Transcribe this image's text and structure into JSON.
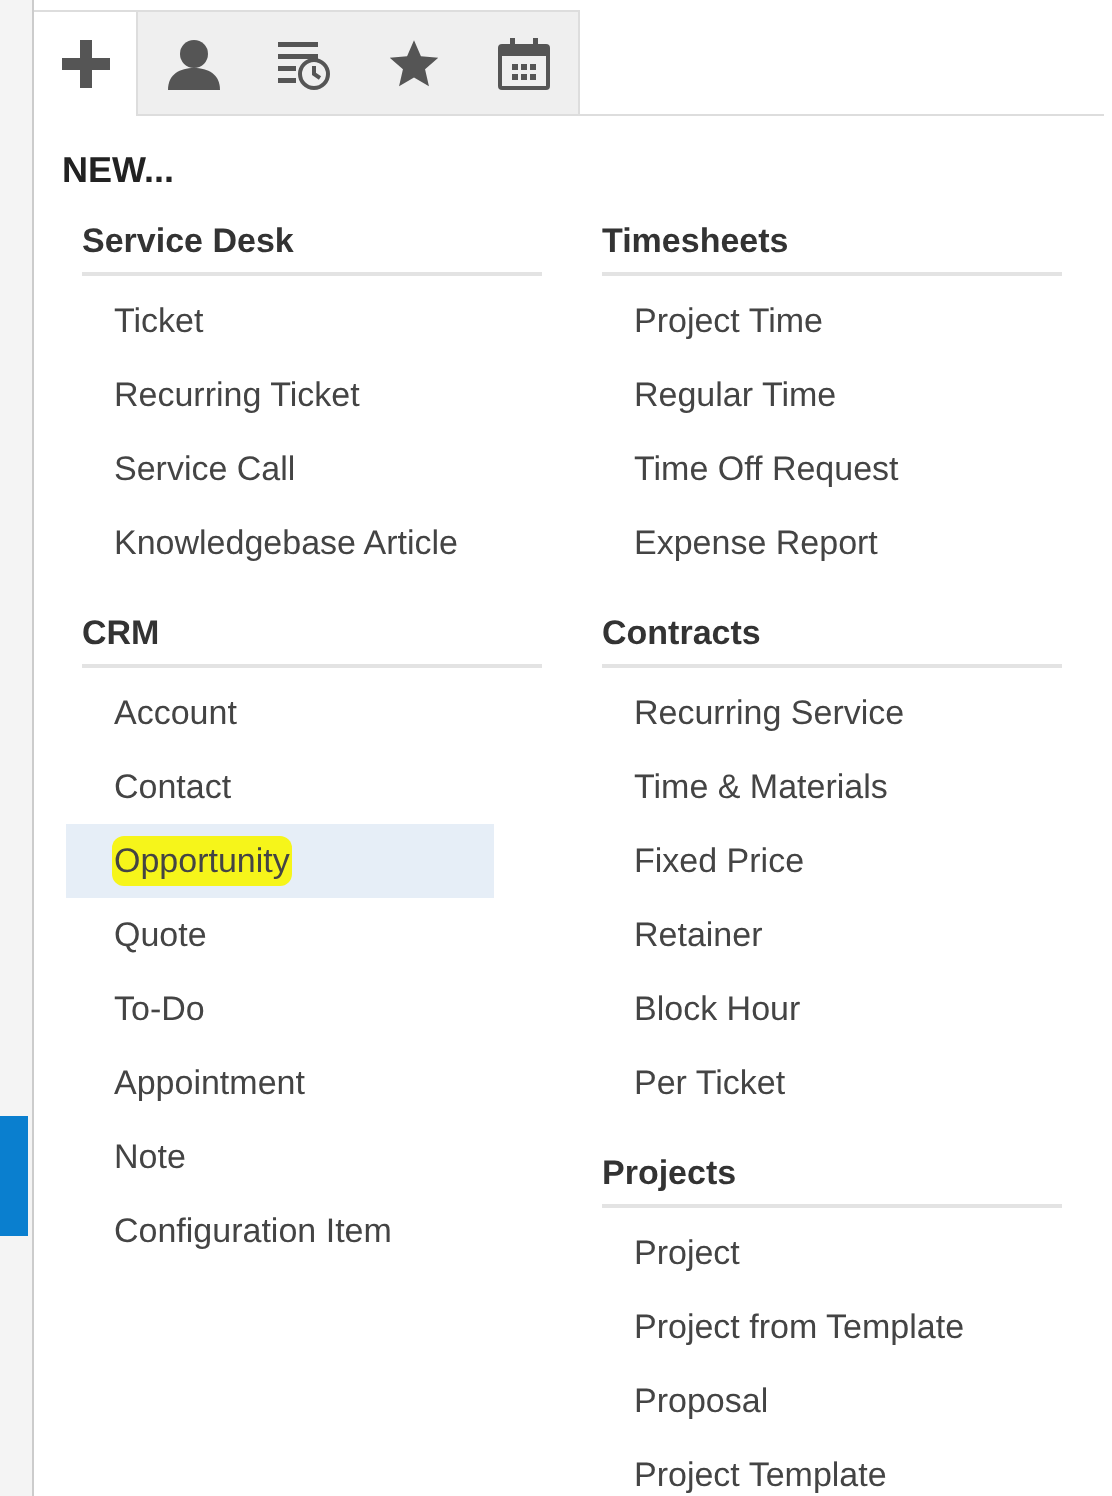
{
  "tabs": [
    {
      "kind": "plus",
      "selected": true
    },
    {
      "kind": "person",
      "selected": false
    },
    {
      "kind": "history",
      "selected": false
    },
    {
      "kind": "star",
      "selected": false
    },
    {
      "kind": "calendar",
      "selected": false
    }
  ],
  "heading": "NEW...",
  "columns": [
    {
      "sections": [
        {
          "title": "Service Desk",
          "items": [
            {
              "label": "Ticket",
              "selected": false,
              "highlighted": false
            },
            {
              "label": "Recurring Ticket",
              "selected": false,
              "highlighted": false
            },
            {
              "label": "Service Call",
              "selected": false,
              "highlighted": false
            },
            {
              "label": "Knowledgebase Article",
              "selected": false,
              "highlighted": false
            }
          ]
        },
        {
          "title": "CRM",
          "items": [
            {
              "label": "Account",
              "selected": false,
              "highlighted": false
            },
            {
              "label": "Contact",
              "selected": false,
              "highlighted": false
            },
            {
              "label": "Opportunity",
              "selected": true,
              "highlighted": true
            },
            {
              "label": "Quote",
              "selected": false,
              "highlighted": false
            },
            {
              "label": "To-Do",
              "selected": false,
              "highlighted": false
            },
            {
              "label": "Appointment",
              "selected": false,
              "highlighted": false
            },
            {
              "label": "Note",
              "selected": false,
              "highlighted": false
            },
            {
              "label": "Configuration Item",
              "selected": false,
              "highlighted": false
            }
          ]
        }
      ]
    },
    {
      "sections": [
        {
          "title": "Timesheets",
          "items": [
            {
              "label": "Project Time",
              "selected": false,
              "highlighted": false
            },
            {
              "label": "Regular Time",
              "selected": false,
              "highlighted": false
            },
            {
              "label": "Time Off Request",
              "selected": false,
              "highlighted": false
            },
            {
              "label": "Expense Report",
              "selected": false,
              "highlighted": false
            }
          ]
        },
        {
          "title": "Contracts",
          "items": [
            {
              "label": "Recurring Service",
              "selected": false,
              "highlighted": false
            },
            {
              "label": "Time & Materials",
              "selected": false,
              "highlighted": false
            },
            {
              "label": "Fixed Price",
              "selected": false,
              "highlighted": false
            },
            {
              "label": "Retainer",
              "selected": false,
              "highlighted": false
            },
            {
              "label": "Block Hour",
              "selected": false,
              "highlighted": false
            },
            {
              "label": "Per Ticket",
              "selected": false,
              "highlighted": false
            }
          ]
        },
        {
          "title": "Projects",
          "items": [
            {
              "label": "Project",
              "selected": false,
              "highlighted": false
            },
            {
              "label": "Project from Template",
              "selected": false,
              "highlighted": false
            },
            {
              "label": "Proposal",
              "selected": false,
              "highlighted": false
            },
            {
              "label": "Project Template",
              "selected": false,
              "highlighted": false
            }
          ]
        }
      ]
    }
  ]
}
